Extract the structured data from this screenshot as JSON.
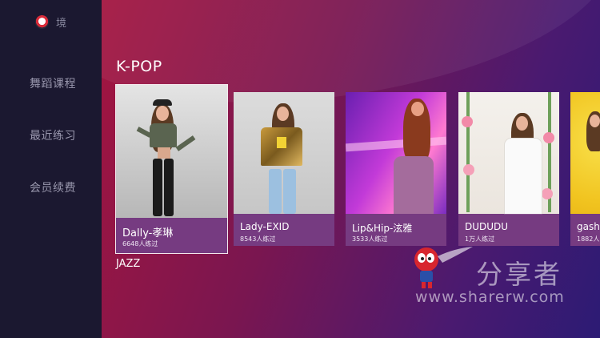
{
  "sidebar": {
    "user_name": "境",
    "items": [
      {
        "label": "舞蹈课程"
      },
      {
        "label": "最近练习"
      },
      {
        "label": "会员续费"
      }
    ]
  },
  "main": {
    "section_title": "K-POP",
    "next_section_title": "JAZZ",
    "cards": [
      {
        "title": "Dally-孝琳",
        "count": "6648人练过"
      },
      {
        "title": "Lady-EXID",
        "count": "8543人练过"
      },
      {
        "title": "Lip&Hip-泫雅",
        "count": "3533人练过"
      },
      {
        "title": "DUDUDU",
        "count": "1万人练过"
      },
      {
        "title": "gashi",
        "count": "1882人"
      }
    ]
  },
  "watermark": {
    "brand": "分享者",
    "url": "www.sharerw.com"
  },
  "colors": {
    "sidebar_bg": "#1b1830",
    "accent_red": "#a3153f",
    "accent_purple": "#2c1b74"
  }
}
